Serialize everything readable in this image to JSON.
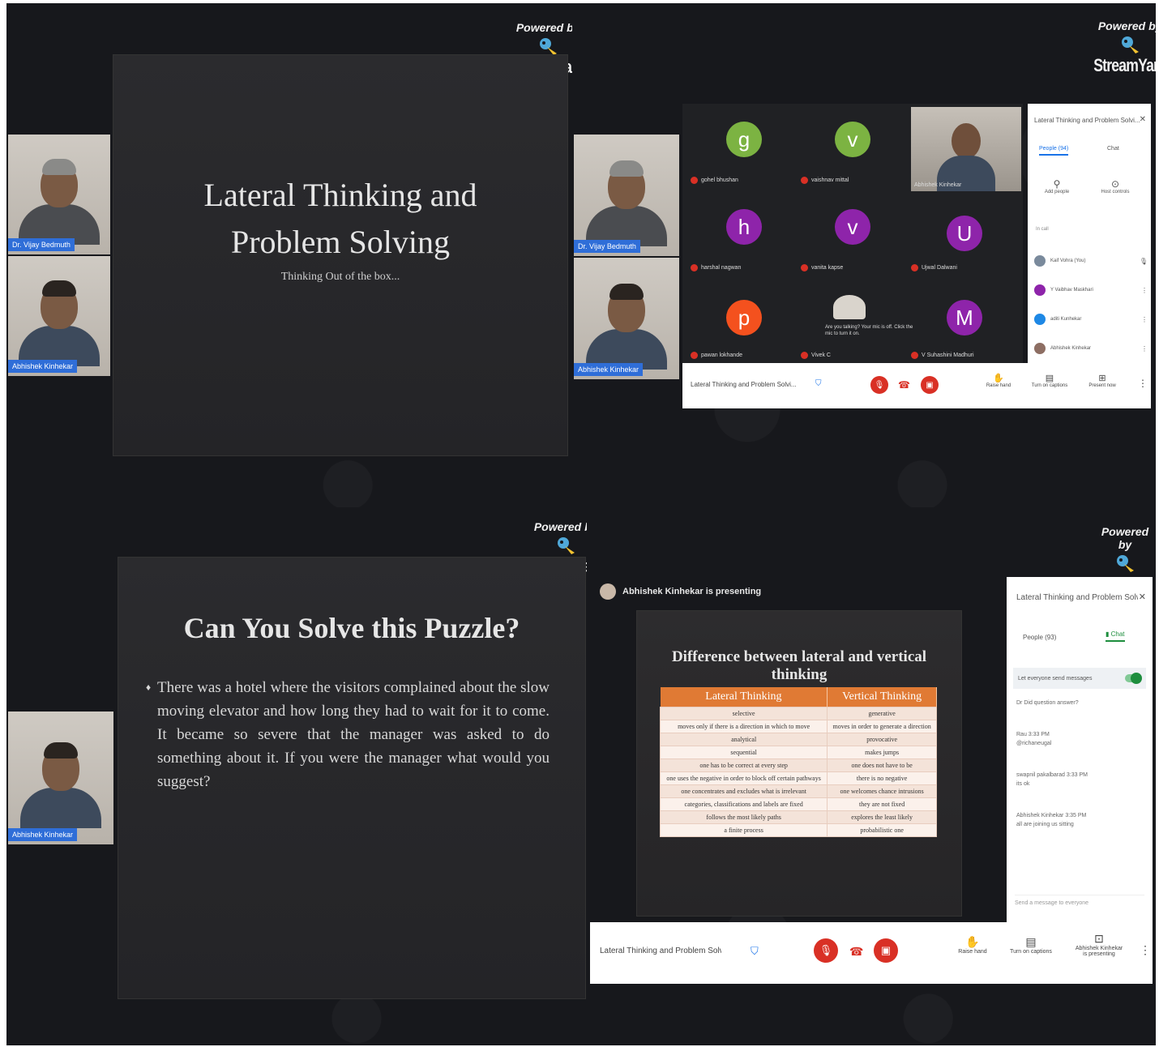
{
  "powered_by": "Powered by",
  "brand": "StreamYard",
  "panel1": {
    "slide_title": "Lateral Thinking and Problem Solving",
    "slide_subtitle": "Thinking Out of the box...",
    "cam1_name": "Dr. Vijay Bedmuth",
    "cam2_name": "Abhishek Kinhekar"
  },
  "panel2": {
    "cam1_name": "Dr. Vijay Bedmuth",
    "cam2_name": "Abhishek Kinhekar",
    "tiles": [
      {
        "letter": "g",
        "color": "#7cb342",
        "name": "gohel bhushan"
      },
      {
        "letter": "v",
        "color": "#7cb342",
        "name": "vaishnav mittal"
      },
      {
        "letter": "h",
        "color": "#8e24aa",
        "name": "harshal nagwan"
      },
      {
        "letter": "v",
        "color": "#8e24aa",
        "name": "vanita kapse"
      },
      {
        "letter": "U",
        "color": "#8e24aa",
        "name": "Ujwal Dalwani"
      },
      {
        "letter": "p",
        "color": "#f4511e",
        "name": "pawan lokhande"
      },
      {
        "letter": "M",
        "color": "#8e24aa",
        "name": "V Suhashini Madhuri"
      }
    ],
    "video_tile_name": "Abhishek Kinhekar",
    "chat_toast": "Are you talking? Your mic is off. Click the mic to turn it on.",
    "video_tile_name_bottom": "Vivek C",
    "meet_title": "Lateral Thinking and Problem Solvi...",
    "side_title": "Lateral Thinking and Problem Solvi...",
    "people_tab": "People (94)",
    "chat_tab": "Chat",
    "add_people": "Add people",
    "host_controls": "Host controls",
    "in_meeting": "In call",
    "people": [
      {
        "name": "Kaif Vohra (You)",
        "color": "#7a8a9c"
      },
      {
        "name": "Y Vaibhav Maskhari",
        "color": "#8e24aa"
      },
      {
        "name": "aditi Kunhekar",
        "color": "#1e88e5"
      },
      {
        "name": "Abhishek Kinhekar",
        "color": "#8d6e63"
      }
    ],
    "raise_hand": "Raise hand",
    "captions": "Turn on captions",
    "present": "Present now"
  },
  "panel3": {
    "slide_title": "Can You Solve this Puzzle?",
    "slide_body": "There was a hotel where the visitors complained about the slow moving elevator and how long they had to wait for it to come. It became so severe that the manager was asked to do something about it. If you were the manager what would you suggest?",
    "cam_name": "Abhishek Kinhekar"
  },
  "panel4": {
    "presenting": "Abhishek Kinhekar is presenting",
    "slide_title": "Difference between lateral and vertical thinking",
    "table_headers": [
      "Lateral Thinking",
      "Vertical Thinking"
    ],
    "table_rows": [
      [
        "selective",
        "generative"
      ],
      [
        "moves only if there is a direction in which to move",
        "moves in order to generate a direction"
      ],
      [
        "analytical",
        "provocative"
      ],
      [
        "sequential",
        "makes jumps"
      ],
      [
        "one has to be correct at every step",
        "one does not have to be"
      ],
      [
        "one uses the negative in order to block off certain pathways",
        "there is no negative"
      ],
      [
        "one concentrates and excludes what is irrelevant",
        "one welcomes chance intrusions"
      ],
      [
        "categories, classifications and labels are fixed",
        "they are not fixed"
      ],
      [
        "follows the most likely paths",
        "explores the least likely"
      ],
      [
        "a finite process",
        "probabilistic one"
      ]
    ],
    "side_title": "Lateral Thinking and Problem Solvi...",
    "people_tab": "People (93)",
    "chat_tab": "Chat",
    "everyone_message": "Let everyone send messages",
    "messages": [
      {
        "sender": "Dr Did question answer?",
        "text": ""
      },
      {
        "sender": "Rau 3:33 PM",
        "text": "@richaneugal"
      },
      {
        "sender": "swapnil pakalbarad 3:33 PM",
        "text": "its ok"
      },
      {
        "sender": "Abhishek Kinhekar 3:35 PM",
        "text": "all are joining us sitting"
      }
    ],
    "send_placeholder": "Send a message to everyone",
    "meet_title": "Lateral Thinking and Problem Solvi...",
    "raise_hand": "Raise hand",
    "captions": "Turn on captions",
    "presenting_btn": "Abhishek Kinhekar is presenting"
  }
}
